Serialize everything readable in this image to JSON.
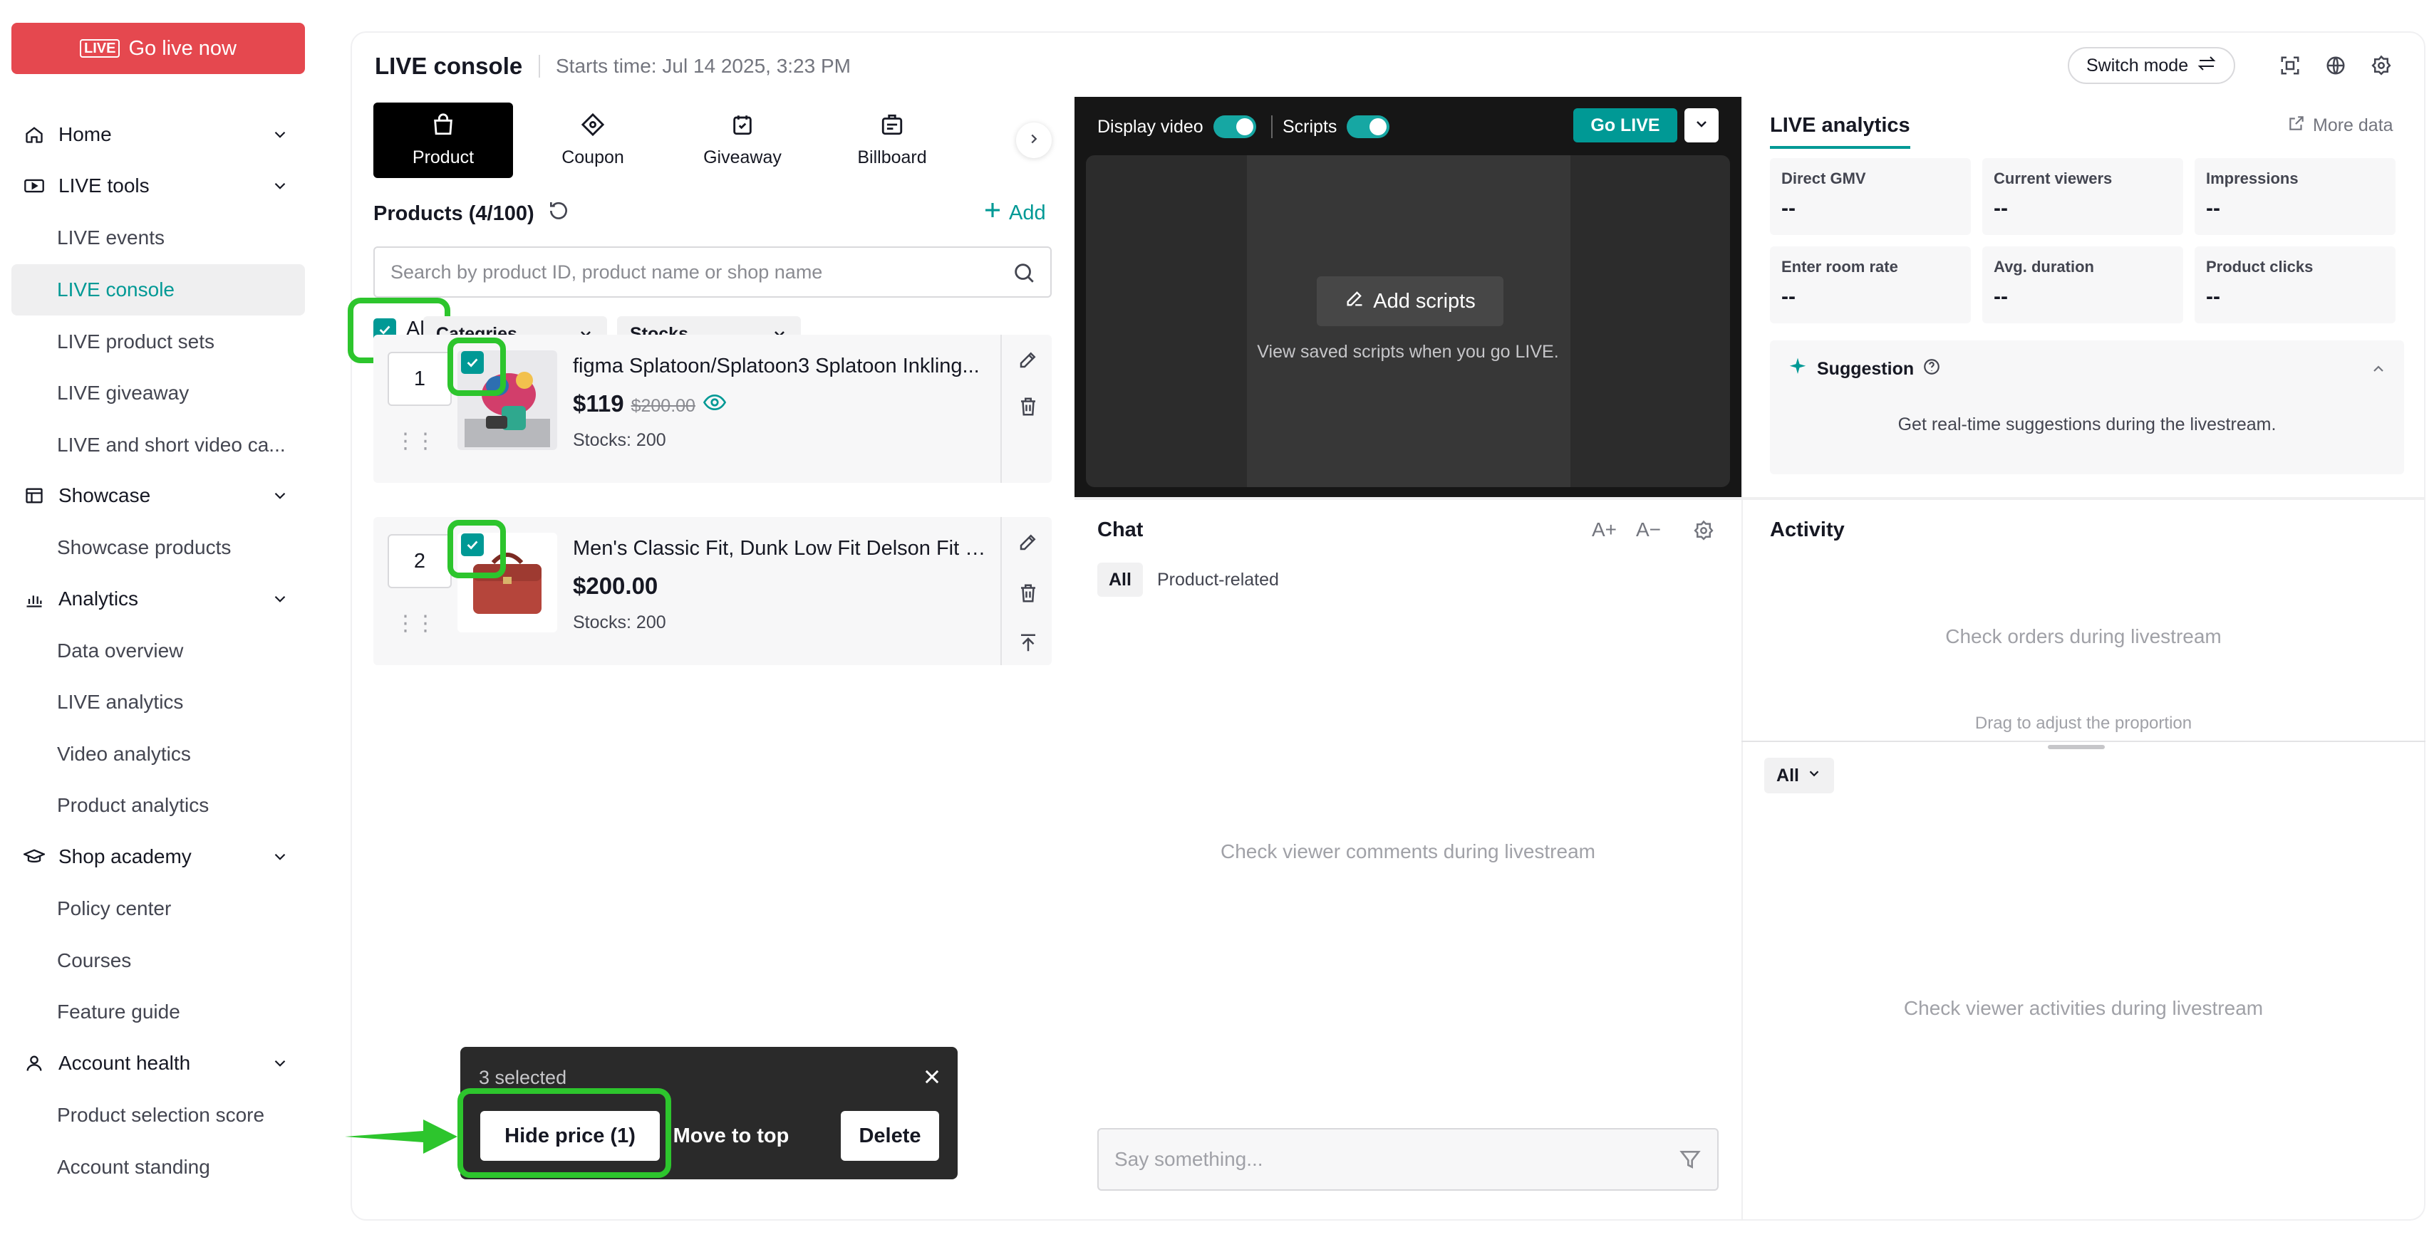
{
  "sidebar": {
    "go_live": "Go live now",
    "go_live_icon_text": "LIVE",
    "groups": [
      {
        "label": "Home",
        "icon": "home-icon"
      },
      {
        "label": "LIVE tools",
        "icon": "live-tools-icon"
      },
      {
        "label": "Showcase",
        "icon": "showcase-icon"
      },
      {
        "label": "Analytics",
        "icon": "analytics-icon"
      },
      {
        "label": "Shop academy",
        "icon": "academy-icon"
      },
      {
        "label": "Account health",
        "icon": "account-icon"
      }
    ],
    "items": [
      "LIVE events",
      "LIVE console",
      "LIVE product sets",
      "LIVE giveaway",
      "LIVE and short video ca...",
      "Showcase products",
      "Data overview",
      "LIVE analytics",
      "Video analytics",
      "Product analytics",
      "Policy center",
      "Courses",
      "Feature guide",
      "Product selection score",
      "Account standing"
    ],
    "active_item": "LIVE console"
  },
  "header": {
    "title": "LIVE console",
    "start_time": "Starts time: Jul 14 2025, 3:23 PM",
    "switch_mode": "Switch mode"
  },
  "tools": {
    "tabs": [
      "Product",
      "Coupon",
      "Giveaway",
      "Billboard"
    ],
    "active": "Product"
  },
  "products": {
    "heading": "Products (4/100)",
    "add": "Add",
    "search_placeholder": "Search by product ID, product name or shop name",
    "all_label": "All",
    "filter_categories": "Categries",
    "filter_stocks": "Stocks",
    "rows": [
      {
        "index": "1",
        "name": "figma Splatoon/Splatoon3 Splatoon Inkling...",
        "price": "$119",
        "original_price": "$200.00",
        "stocks": "Stocks: 200"
      },
      {
        "index": "2",
        "name": "Men's Classic Fit, Dunk Low Fit Delson Fit S...",
        "price": "$200.00",
        "original_price": "",
        "stocks": "Stocks: 200"
      }
    ]
  },
  "video": {
    "display_video": "Display video",
    "scripts": "Scripts",
    "go_live": "Go LIVE",
    "add_scripts": "Add scripts",
    "scripts_hint": "View saved scripts when you go LIVE."
  },
  "analytics": {
    "title": "LIVE analytics",
    "more": "More data",
    "metrics": [
      {
        "label": "Direct GMV",
        "value": "--"
      },
      {
        "label": "Current viewers",
        "value": "--"
      },
      {
        "label": "Impressions",
        "value": "--"
      },
      {
        "label": "Enter room rate",
        "value": "--"
      },
      {
        "label": "Avg. duration",
        "value": "--"
      },
      {
        "label": "Product clicks",
        "value": "--"
      }
    ],
    "suggestion_title": "Suggestion",
    "suggestion_text": "Get real-time suggestions during the livestream."
  },
  "chat": {
    "title": "Chat",
    "font_up": "A+",
    "font_down": "A−",
    "chips": [
      "All",
      "Product-related"
    ],
    "empty": "Check viewer comments during livestream",
    "input_placeholder": "Say something..."
  },
  "activity": {
    "title": "Activity",
    "orders_empty": "Check orders during livestream",
    "drag_hint": "Drag to adjust the proportion",
    "filter": "All",
    "empty": "Check viewer activities during livestream"
  },
  "selection_bar": {
    "count": "3 selected",
    "hide_price": "Hide price (1)",
    "move_top": "Move to top",
    "delete": "Delete"
  },
  "colors": {
    "accent": "#009995",
    "go_live": "#e5484f",
    "highlight": "#2dc52d"
  }
}
